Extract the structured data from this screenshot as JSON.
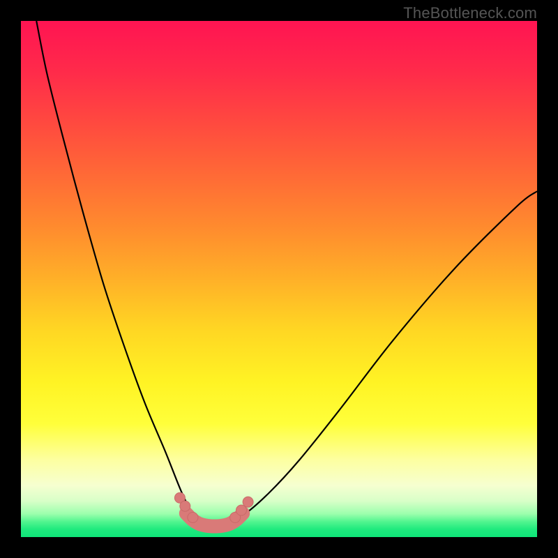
{
  "watermark": "TheBottleneck.com",
  "chart_data": {
    "type": "line",
    "title": "",
    "xlabel": "",
    "ylabel": "",
    "xlim": [
      0,
      100
    ],
    "ylim": [
      0,
      100
    ],
    "grid": false,
    "series": [
      {
        "name": "left-curve",
        "x": [
          3,
          5,
          8,
          12,
          16,
          20,
          24,
          28,
          31,
          33,
          34.5,
          36
        ],
        "values": [
          100,
          90,
          78,
          63,
          49,
          37,
          26,
          16.5,
          9,
          5,
          3.2,
          2.4
        ]
      },
      {
        "name": "valley-floor",
        "x": [
          32,
          33.2,
          34.5,
          36,
          37.5,
          39,
          40.5,
          41.8,
          43
        ],
        "values": [
          4.6,
          3.4,
          2.6,
          2.2,
          2.1,
          2.2,
          2.6,
          3.4,
          4.6
        ]
      },
      {
        "name": "right-curve",
        "x": [
          39,
          43,
          48,
          54,
          62,
          72,
          84,
          96,
          100
        ],
        "values": [
          2.4,
          4.2,
          8.5,
          15,
          25,
          38,
          52,
          64,
          67
        ]
      },
      {
        "name": "left-markers",
        "x": [
          30.8,
          31.8,
          33.3
        ],
        "values": [
          7.6,
          6.0,
          3.8
        ]
      },
      {
        "name": "right-markers",
        "x": [
          41.5,
          42.7,
          44.0
        ],
        "values": [
          3.8,
          5.2,
          6.8
        ]
      }
    ],
    "gradient_stops": [
      {
        "offset": 0.0,
        "color": "#ff1452"
      },
      {
        "offset": 0.1,
        "color": "#ff2b4a"
      },
      {
        "offset": 0.2,
        "color": "#ff4a3f"
      },
      {
        "offset": 0.3,
        "color": "#ff6a36"
      },
      {
        "offset": 0.4,
        "color": "#ff8b2e"
      },
      {
        "offset": 0.5,
        "color": "#ffb028"
      },
      {
        "offset": 0.6,
        "color": "#ffd723"
      },
      {
        "offset": 0.7,
        "color": "#fff324"
      },
      {
        "offset": 0.78,
        "color": "#ffff3a"
      },
      {
        "offset": 0.85,
        "color": "#fdffa0"
      },
      {
        "offset": 0.9,
        "color": "#f6ffd0"
      },
      {
        "offset": 0.93,
        "color": "#d8ffc8"
      },
      {
        "offset": 0.955,
        "color": "#9cffad"
      },
      {
        "offset": 0.97,
        "color": "#52f58f"
      },
      {
        "offset": 0.985,
        "color": "#1fea7e"
      },
      {
        "offset": 1.0,
        "color": "#0fe679"
      }
    ],
    "colors": {
      "curve": "#000000",
      "marker_fill": "#d97a78",
      "marker_stroke": "#c96a68"
    }
  }
}
